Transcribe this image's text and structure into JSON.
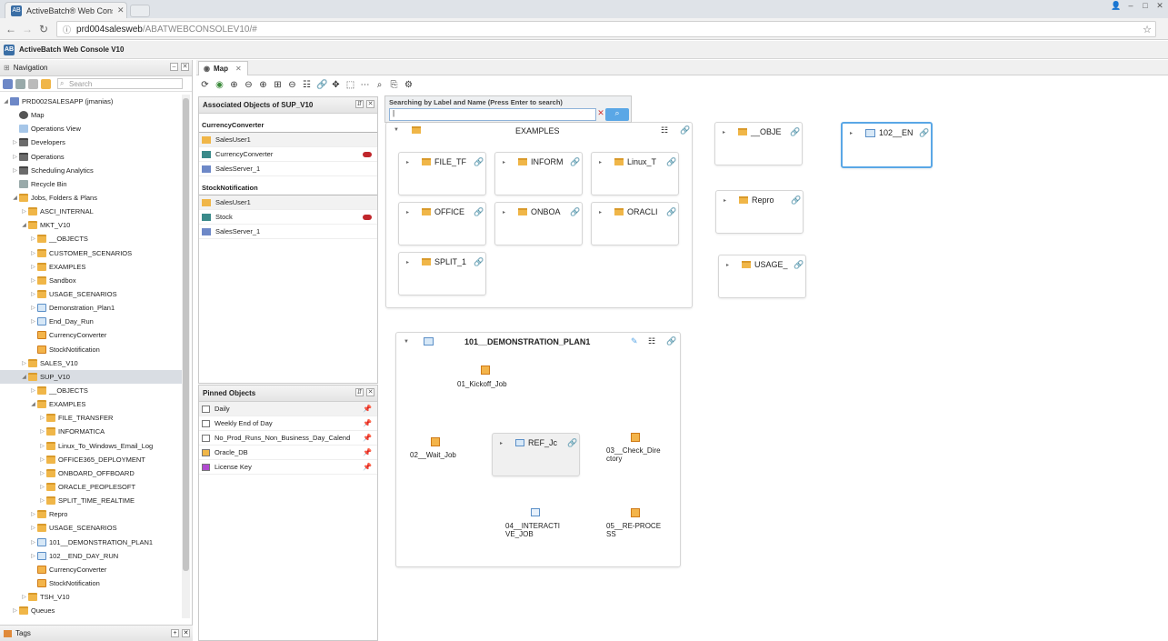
{
  "browser": {
    "tab_title": "ActiveBatch® Web Conso",
    "url_host": "prd004salesweb",
    "url_path": "/ABATWEBCONSOLEV10/#"
  },
  "app": {
    "title": "ActiveBatch Web Console V10"
  },
  "navigation": {
    "title": "Navigation",
    "search_placeholder": "Search",
    "tree": [
      {
        "label": "PRD002SALESAPP (jmanias)",
        "level": 0,
        "icon": "srv",
        "arrow": "◢"
      },
      {
        "label": "Map",
        "level": 1,
        "icon": "map",
        "arrow": ""
      },
      {
        "label": "Operations View",
        "level": 1,
        "icon": "ops",
        "arrow": ""
      },
      {
        "label": "Developers",
        "level": 1,
        "icon": "folderg",
        "arrow": "▷"
      },
      {
        "label": "Operations",
        "level": 1,
        "icon": "folderg",
        "arrow": "▷"
      },
      {
        "label": "Scheduling Analytics",
        "level": 1,
        "icon": "folderg",
        "arrow": "▷"
      },
      {
        "label": "Recycle Bin",
        "level": 1,
        "icon": "bin",
        "arrow": ""
      },
      {
        "label": "Jobs, Folders & Plans",
        "level": 1,
        "icon": "folder",
        "arrow": "◢"
      },
      {
        "label": "ASCI_INTERNAL",
        "level": 2,
        "icon": "folder",
        "arrow": "▷"
      },
      {
        "label": "MKT_V10",
        "level": 2,
        "icon": "folder",
        "arrow": "◢"
      },
      {
        "label": "__OBJECTS",
        "level": 3,
        "icon": "folder",
        "arrow": "▷"
      },
      {
        "label": "CUSTOMER_SCENARIOS",
        "level": 3,
        "icon": "folder",
        "arrow": "▷"
      },
      {
        "label": "EXAMPLES",
        "level": 3,
        "icon": "folder",
        "arrow": "▷"
      },
      {
        "label": "Sandbox",
        "level": 3,
        "icon": "folder",
        "arrow": "▷"
      },
      {
        "label": "USAGE_SCENARIOS",
        "level": 3,
        "icon": "folder",
        "arrow": "▷"
      },
      {
        "label": "Demonstration_Plan1",
        "level": 3,
        "icon": "plan",
        "arrow": "▷"
      },
      {
        "label": "End_Day_Run",
        "level": 3,
        "icon": "plan",
        "arrow": "▷"
      },
      {
        "label": "CurrencyConverter",
        "level": 3,
        "icon": "job",
        "arrow": ""
      },
      {
        "label": "StockNotification",
        "level": 3,
        "icon": "job",
        "arrow": ""
      },
      {
        "label": "SALES_V10",
        "level": 2,
        "icon": "folder",
        "arrow": "▷"
      },
      {
        "label": "SUP_V10",
        "level": 2,
        "icon": "folder",
        "arrow": "◢",
        "selected": true
      },
      {
        "label": "__OBJECTS",
        "level": 3,
        "icon": "folder",
        "arrow": "▷"
      },
      {
        "label": "EXAMPLES",
        "level": 3,
        "icon": "folder",
        "arrow": "◢"
      },
      {
        "label": "FILE_TRANSFER",
        "level": 4,
        "icon": "folder",
        "arrow": "▷"
      },
      {
        "label": "INFORMATICA",
        "level": 4,
        "icon": "folder",
        "arrow": "▷"
      },
      {
        "label": "Linux_To_Windows_Email_Log",
        "level": 4,
        "icon": "folder",
        "arrow": "▷"
      },
      {
        "label": "OFFICE365_DEPLOYMENT",
        "level": 4,
        "icon": "folder",
        "arrow": "▷"
      },
      {
        "label": "ONBOARD_OFFBOARD",
        "level": 4,
        "icon": "folder",
        "arrow": "▷"
      },
      {
        "label": "ORACLE_PEOPLESOFT",
        "level": 4,
        "icon": "folder",
        "arrow": "▷"
      },
      {
        "label": "SPLIT_TIME_REALTIME",
        "level": 4,
        "icon": "folder",
        "arrow": "▷"
      },
      {
        "label": "Repro",
        "level": 3,
        "icon": "folder",
        "arrow": "▷"
      },
      {
        "label": "USAGE_SCENARIOS",
        "level": 3,
        "icon": "folder",
        "arrow": "▷"
      },
      {
        "label": "101__DEMONSTRATION_PLAN1",
        "level": 3,
        "icon": "plan",
        "arrow": "▷"
      },
      {
        "label": "102__END_DAY_RUN",
        "level": 3,
        "icon": "plan",
        "arrow": "▷"
      },
      {
        "label": "CurrencyConverter",
        "level": 3,
        "icon": "job",
        "arrow": ""
      },
      {
        "label": "StockNotification",
        "level": 3,
        "icon": "job",
        "arrow": ""
      },
      {
        "label": "TSH_V10",
        "level": 2,
        "icon": "folder",
        "arrow": "▷"
      },
      {
        "label": "Queues",
        "level": 1,
        "icon": "folder",
        "arrow": "▷"
      }
    ],
    "tags_label": "Tags"
  },
  "map_tab": {
    "label": "Map"
  },
  "associated": {
    "title": "Associated Objects of SUP_V10",
    "sections": [
      {
        "name": "CurrencyConverter",
        "items": [
          "SalesUser1",
          "CurrencyConverter",
          "SalesServer_1"
        ]
      },
      {
        "name": "StockNotification",
        "items": [
          "SalesUser1",
          "Stock",
          "SalesServer_1"
        ]
      }
    ]
  },
  "pinned": {
    "title": "Pinned Objects",
    "items": [
      "Daily",
      "Weekly End of Day",
      "No_Prod_Runs_Non_Business_Day_Calend",
      "Oracle_DB",
      "License Key"
    ]
  },
  "search": {
    "label": "Searching by Label and Name (Press Enter to search)",
    "value": "|"
  },
  "map": {
    "examples_title": "EXAMPLES",
    "examples_children": [
      "FILE_TF",
      "INFORM",
      "Linux_T",
      "OFFICE",
      "ONBOA",
      "ORACLI",
      "SPLIT_1"
    ],
    "objects_label": "__OBJE",
    "repro_label": "Repro",
    "usage_label": "USAGE_",
    "end_label": "102__EN",
    "plan_title": "101__DEMONSTRATION_PLAN1",
    "jobs": {
      "kickoff": "01_Kickoff_Job",
      "wait": "02__Wait_Job",
      "ref": "REF_Jc",
      "check": "03__Check_Dire ctory",
      "interactive": "04__INTERACTI VE_JOB",
      "reprocess": "05__RE-PROCE SS"
    }
  }
}
